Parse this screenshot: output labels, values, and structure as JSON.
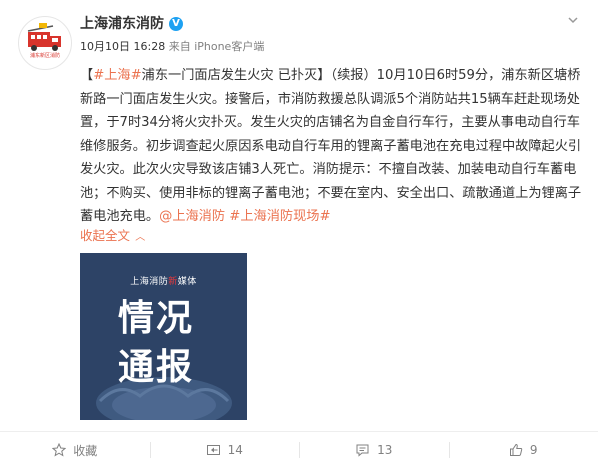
{
  "author": {
    "name": "上海浦东消防",
    "verified": "V",
    "avatar_caption": "浦东新区消防"
  },
  "meta": {
    "time": "10月10日 16:28",
    "source": "来自 iPhone客户端"
  },
  "post": {
    "open_bracket": "【",
    "topic": "#上海#",
    "headline": "浦东一门面店发生火灾 已扑灭】（续报）",
    "body": "10月10日6时59分，浦东新区塘桥新路一门面店发生火灾。接警后，市消防救援总队调派5个消防站共15辆车赶赴现场处置，于7时34分将火灾扑灭。发生火灾的店铺名为自金自行车行，主要从事电动自行车维修服务。初步调查起火原因系电动自行车用的锂离子蓄电池在充电过程中故障起火引发火灾。此次火灾导致该店铺3人死亡。消防提示：不擅自改装、加装电动自行车蓄电池；不购买、使用非标的锂离子蓄电池；不要在室内、安全出口、疏散通道上为锂离子蓄电池充电。",
    "mention": "@上海消防",
    "tag": "#上海消防现场#"
  },
  "collapse_label": "收起全文",
  "image": {
    "banner_pre": "上海消防",
    "banner_red": "新",
    "banner_post": "媒体",
    "line1": "情况",
    "line2": "通报"
  },
  "actions": {
    "favorite": "收藏",
    "repost": "14",
    "comment": "13",
    "like": "9"
  },
  "colors": {
    "link": "#eb7350",
    "verified": "#1da1f2",
    "image_bg": "#2d4366"
  }
}
